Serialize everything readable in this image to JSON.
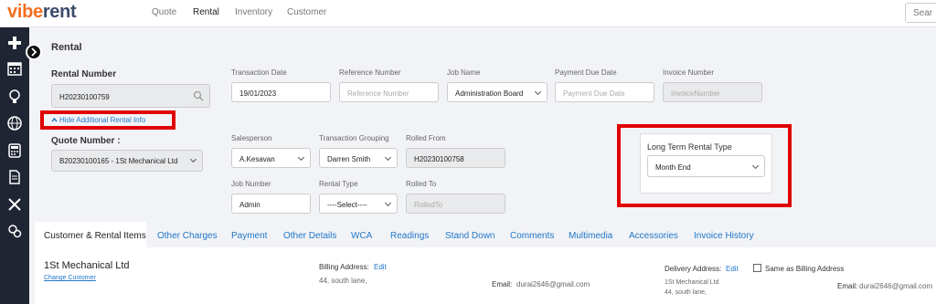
{
  "logo": {
    "part1": "vibe",
    "part2": "rent"
  },
  "nav": {
    "quote": "Quote",
    "rental": "Rental",
    "inventory": "Inventory",
    "customer": "Customer"
  },
  "search": {
    "text": "Sear"
  },
  "section_title": "Rental",
  "rental_number": {
    "label": "Rental Number",
    "value": "H20230100759"
  },
  "hide_info_link": "Hide Additional Rental Info",
  "quote_number": {
    "label": "Quote Number :",
    "value": "B20230100165 - 1St Mechanical Ltd"
  },
  "transaction_date": {
    "label": "Transaction Date",
    "value": "19/01/2023"
  },
  "reference_number": {
    "label": "Reference Number",
    "placeholder": "Reference Number"
  },
  "job_name": {
    "label": "Job Name",
    "value": "Administration Board"
  },
  "payment_due_date": {
    "label": "Payment Due Date",
    "placeholder": "Payment Due Date"
  },
  "invoice_number": {
    "label": "Invoice Number",
    "placeholder": "InvoiceNumber"
  },
  "salesperson": {
    "label": "Salesperson",
    "value": "A.Kesavan"
  },
  "transaction_grouping": {
    "label": "Transaction Grouping",
    "value": "Darren Smith"
  },
  "rolled_from": {
    "label": "Rolled From",
    "value": "H20230100758"
  },
  "job_number": {
    "label": "Job Number",
    "value": "Admin"
  },
  "rental_type": {
    "label": "Rental Type",
    "value": "----Select----"
  },
  "rolled_to": {
    "label": "Rolled To",
    "placeholder": "RolledTo"
  },
  "long_term_rental": {
    "label": "Long Term Rental Type",
    "value": "Month End"
  },
  "tabs": [
    "Customer & Rental Items",
    "Other Charges",
    "Payment",
    "Other Details",
    "WCA",
    "Readings",
    "Stand Down",
    "Comments",
    "Multimedia",
    "Accessories",
    "Invoice History"
  ],
  "customer": {
    "name": "1St Mechanical Ltd",
    "change_link": "Change Customer",
    "billing_label": "Billing Address:",
    "billing_edit": "Edit",
    "billing_address": "44, south lane,",
    "email_label": "Email:",
    "email": "durai2646@gmail.com",
    "delivery_label": "Delivery Address:",
    "delivery_edit": "Edit",
    "same_as_billing": "Same as Billing Address",
    "delivery_name": "1St Mechanical Ltd",
    "delivery_address": "44, south lane,",
    "email2_label": "Email:",
    "email2": "durai2646@gmail.com"
  },
  "colors": {
    "brand_orange": "#f36f21",
    "brand_navy": "#3d4b6b",
    "sidebar": "#1f2533",
    "link_blue": "#1f77c9",
    "highlight_red": "#e10000"
  },
  "sidebar_icons": [
    "plus-icon",
    "calendar-icon",
    "lightbulb-icon",
    "globe-icon",
    "calculator-icon",
    "document-icon",
    "tools-icon",
    "gears-icon"
  ]
}
